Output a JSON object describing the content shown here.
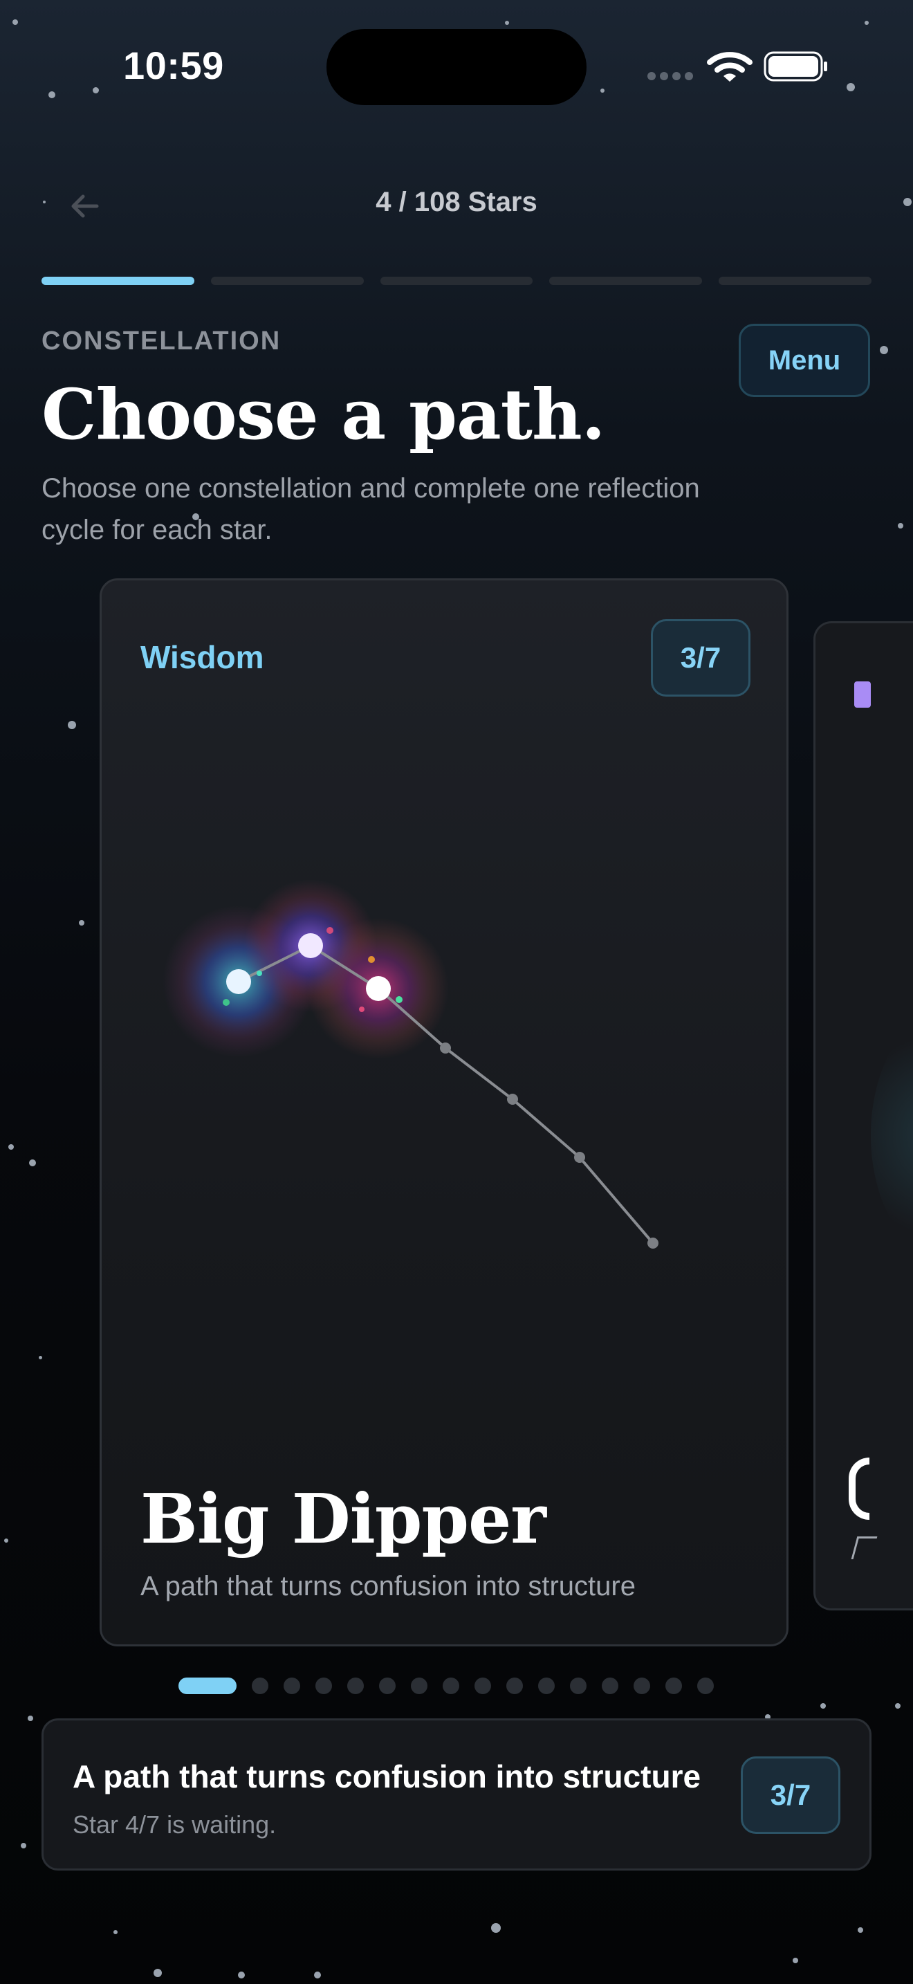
{
  "status_bar": {
    "time": "10:59"
  },
  "header": {
    "counter": "4 / 108 Stars",
    "back_icon": "arrow-left-icon"
  },
  "progress": {
    "segments": 5,
    "active_segment": 1
  },
  "section_label": "CONSTELLATION",
  "menu_label": "Menu",
  "title": "Choose a path.",
  "subtitle": "Choose one constellation and complete one reflection cycle for each star.",
  "card": {
    "category": "Wisdom",
    "progress": "3/7",
    "name": "Big Dipper",
    "description": "A path that turns confusion into structure",
    "stars_completed": 3,
    "stars_total": 7
  },
  "pager": {
    "pages": 16,
    "current": 1
  },
  "summary": {
    "title": "A path that turns confusion into structure",
    "subtitle": "Star 4/7 is waiting.",
    "badge": "3/7"
  },
  "colors": {
    "accent": "#7fd1f5",
    "background": "#07090d",
    "card": "#1b1d22"
  }
}
